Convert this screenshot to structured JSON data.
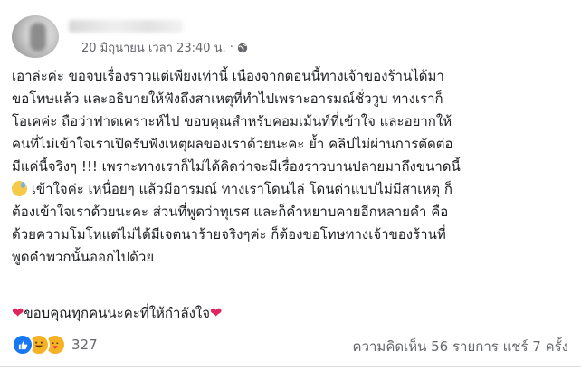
{
  "post": {
    "author_blurred": true,
    "timestamp": "20 มิถุนายน เวลา 23:40 น.",
    "separator": "·",
    "privacy_icon": "globe-icon",
    "lines": [
      "เอาล่ะค่ะ ขอจบเรื่องราวแต่เพียงเท่านี้ เนื่องจากตอนนี้ทางเจ้าของร้านได้มา",
      "ขอโทษแล้ว และอธิบายให้ฟังถึงสาเหตุที่ทำไปเพราะอารมณ์ชั่ววูบ ทางเราก็",
      "โอเคค่ะ ถือว่าฟาดเคราะห์ไป ขอบคุณสำหรับคอมเม้นท์ที่เข้าใจ และอยากให้",
      "คนที่ไม่เข้าใจเราเปิดรับฟังเหตุผลของเราด้วยนะคะ ย้ำ คลิปไม่ผ่านการตัดต่อ",
      "มีแค่นี้จริงๆ !!! เพราะทางเราก็ไม่ได้คิดว่าจะมีเรื่องราวบานปลายมาถึงขนาดนี้",
      "เข้าใจค่ะ เหนื่อยๆ แล้วมีอารมณ์ ทางเราโดนไล่ โดนด่าแบบไม่มีสาเหตุ ก็",
      "ต้องเข้าใจเราด้วยนะคะ ส่วนที่พูดว่าทุเรศ และก็คำหยาบคายอีกหลายคำ คือ",
      "ด้วยความโมโหแต่ไม่ได้มีเจตนาร้ายจริงๆค่ะ ก็ต้องขอโทษทางเจ้าของร้านที่",
      "พูดคำพวกนั้นออกไปด้วย"
    ],
    "thanks_text": "ขอบคุณทุกคนนะคะที่ให้กำลังใจ"
  },
  "footer": {
    "reaction_count": "327",
    "comments": "ความคิดเห็น 56 รายการ",
    "shares": "แชร์ 7 ครั้ง"
  },
  "colors": {
    "like": "#1877f2",
    "reaction_yellow": "#f7b125",
    "heart": "#e0245e",
    "muted_text": "#65676b"
  }
}
